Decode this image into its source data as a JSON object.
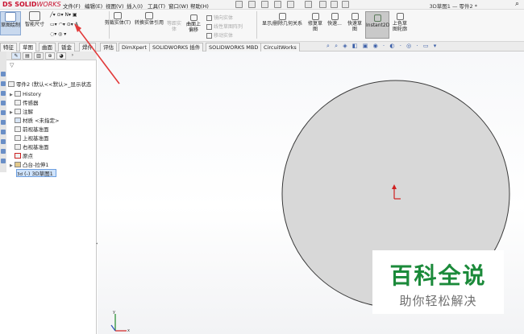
{
  "app": {
    "logo_prefix": "DS",
    "logo_solid": "SOLID",
    "logo_works": "WORKS",
    "brand_color": "#c8102e"
  },
  "menubar": {
    "items": [
      "文件(F)",
      "编辑(E)",
      "视图(V)",
      "插入(I)",
      "工具(T)",
      "窗口(W)",
      "帮助(H)"
    ],
    "document_title": "3D草图1 — 零件2 *"
  },
  "ribbon": {
    "sketch_button": "草图绘制",
    "smart_dimension": "智能尺寸",
    "convert_entities": "剪裁实体(T)",
    "offset_entities": "转换实体引用",
    "surface_offset_1": "等距实",
    "surface_offset_2": "体",
    "offset_on_surface_1": "曲面上",
    "offset_on_surface_2": "偏移",
    "mirror_entities": "镜向实体",
    "linear_pattern": "线性草图阵列",
    "move_entities": "移动实体",
    "display_relations": "显示/删除几何关系",
    "repair_sketch_1": "修复草",
    "repair_sketch_2": "图",
    "quick_snap": "快速...",
    "rapid_sketch_1": "快速草",
    "rapid_sketch_2": "图",
    "instant2d": "Instant2D",
    "shaded_sketch_1": "上色草",
    "shaded_sketch_2": "图轮廓"
  },
  "tabs": [
    "特征",
    "草图",
    "曲面",
    "钣金",
    "焊件",
    "评估",
    "DimXpert",
    "SOLIDWORKS 插件",
    "SOLIDWORKS MBD",
    "CircuitWorks"
  ],
  "tree": {
    "root": "零件2 (默认<<默认>_显示状态",
    "history": "History",
    "sensors": "传感器",
    "annotations": "注解",
    "material": "材质 <未指定>",
    "front_plane": "前视基准面",
    "top_plane": "上视基准面",
    "right_plane": "右视基准面",
    "origin": "原点",
    "boss_extrude": "凸台-拉伸1",
    "sketch3d": "(-) 3D草图1",
    "sketch3d_prefix": "3d"
  },
  "watermark": {
    "title": "百科全说",
    "subtitle": "助你轻松解决",
    "color": "#1b8a3a"
  },
  "graphics": {
    "circle_fill": "#d8d8d8",
    "circle_stroke": "#3a3a3a",
    "triad_x_color": "#d02020",
    "triad_y_color": "#1e8a2a"
  },
  "icons": {
    "search": "search-icon",
    "filter": "filter-icon",
    "triad": "triad-icon",
    "origin": "origin-icon"
  }
}
